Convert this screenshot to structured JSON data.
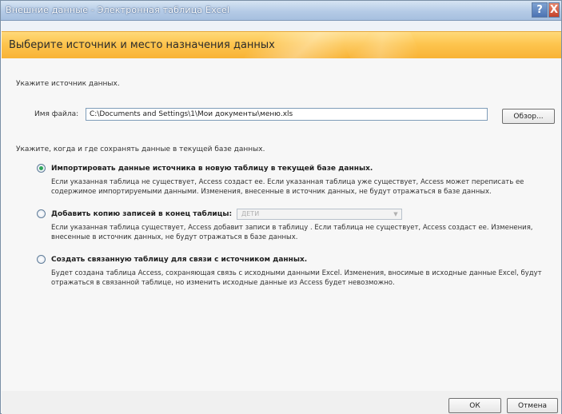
{
  "window": {
    "title": "Внешние данные - Электронная таблица Excel",
    "help_label": "?",
    "close_label": "X"
  },
  "header": {
    "title": "Выберите источник и место назначения данных"
  },
  "source": {
    "section_label": "Укажите источник данных.",
    "file_label": "Имя файла:",
    "file_value": "C:\\Documents and Settings\\1\\Мои документы\\меню.xls",
    "browse_label": "Обзор..."
  },
  "destination": {
    "section_label": "Укажите, когда и где сохранять данные в текущей базе данных.",
    "options": [
      {
        "label": "Импортировать данные источника в новую таблицу в текущей базе данных.",
        "selected": true,
        "desc_line1": "Если указанная таблица не существует, Access создаст ее. Если указанная таблица уже существует, Access может переписать ее",
        "desc_line2": "содержимое импортируемыми данными. Изменения, внесенные в источник данных, не будут отражаться в базе данных."
      },
      {
        "label": "Добавить копию записей в конец таблицы:",
        "selected": false,
        "combo_value": "ДЕТИ",
        "desc_line1": "Если указанная таблица существует, Access добавит записи в таблицу . Если таблица не существует, Access создаст ее. Изменения,",
        "desc_line2": "внесенные в источник данных, не будут отражаться в базе данных."
      },
      {
        "label": "Создать связанную таблицу для связи с источником данных.",
        "selected": false,
        "desc_line1": "Будет создана таблица Access, сохраняющая связь с исходными данными Excel. Изменения, вносимые в исходные данные Excel, будут",
        "desc_line2": "отражаться в связанной таблице, но изменить исходные данные из Access будет невозможно."
      }
    ]
  },
  "footer": {
    "ok_label": "ОК",
    "cancel_label": "Отмена"
  },
  "colors": {
    "accent_band": "#fdc54f",
    "title_bar": "#b5cbe6",
    "radio_selected": "#2ea55a"
  }
}
